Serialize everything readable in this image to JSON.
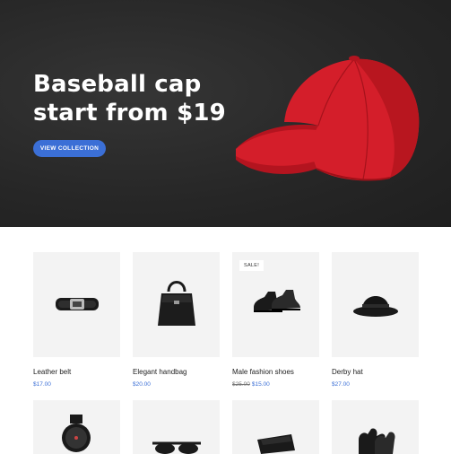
{
  "hero": {
    "title_line1": "Baseball cap",
    "title_line2": "start from $19",
    "cta_label": "VIEW COLLECTION",
    "accent_color": "#3b6fd6",
    "cap_color": "#d41e2a"
  },
  "products": [
    {
      "name": "Leather belt",
      "price": "$17.00",
      "image": "belt-icon"
    },
    {
      "name": "Elegant handbag",
      "price": "$20.00",
      "image": "handbag-icon"
    },
    {
      "name": "Male fashion shoes",
      "old_price": "$25.00",
      "price": "$15.00",
      "badge": "SALE!",
      "image": "shoes-icon"
    },
    {
      "name": "Derby hat",
      "price": "$27.00",
      "image": "hat-icon"
    }
  ],
  "products_row2": [
    {
      "image": "watch-icon"
    },
    {
      "image": "sunglasses-icon"
    },
    {
      "image": "wallet-icon"
    },
    {
      "image": "gloves-icon"
    }
  ]
}
